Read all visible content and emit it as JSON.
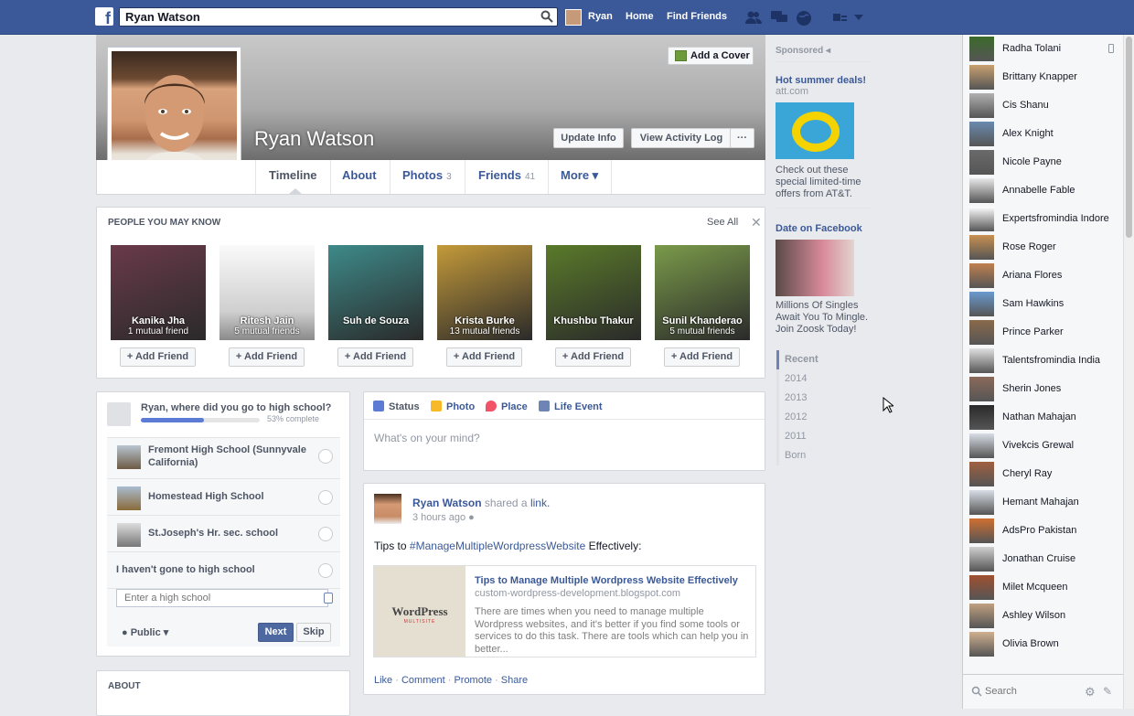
{
  "topbar": {
    "search_value": "Ryan Watson",
    "user_name": "Ryan",
    "home": "Home",
    "find_friends": "Find Friends"
  },
  "cover": {
    "add_cover": "Add a Cover",
    "name": "Ryan Watson",
    "update_info": "Update Info",
    "activity_log": "View Activity Log",
    "more_dots": "···"
  },
  "tabs": [
    {
      "label": "Timeline",
      "count": ""
    },
    {
      "label": "About",
      "count": ""
    },
    {
      "label": "Photos",
      "count": "3"
    },
    {
      "label": "Friends",
      "count": "41"
    },
    {
      "label": "More ▾",
      "count": ""
    }
  ],
  "pymk": {
    "title": "PEOPLE YOU MAY KNOW",
    "see_all": "See All",
    "add_label": "Add Friend",
    "people": [
      {
        "name": "Kanika Jha",
        "mutual": "1 mutual friend",
        "color": "#6a3a4a"
      },
      {
        "name": "Ritesh Jain",
        "mutual": "5 mutual friends",
        "color": "#e8e8e8"
      },
      {
        "name": "Suh de Souza",
        "mutual": "",
        "color": "#3e8a8a"
      },
      {
        "name": "Krista Burke",
        "mutual": "13 mutual friends",
        "color": "#c49a3a"
      },
      {
        "name": "Khushbu Thakur",
        "mutual": "",
        "color": "#5a7a2a"
      },
      {
        "name": "Sunil Khanderao",
        "mutual": "5 mutual friends",
        "color": "#7a9a4a"
      }
    ]
  },
  "highschool": {
    "question": "Ryan, where did you go to high school?",
    "progress_percent": 53,
    "progress_text": "53% complete",
    "options": [
      "Fremont High School (Sunnyvale California)",
      "Homestead High School",
      "St.Joseph's Hr. sec. school",
      "I haven't gone to high school"
    ],
    "input_placeholder": "Enter a high school",
    "privacy": "Public",
    "next": "Next",
    "skip": "Skip"
  },
  "about": {
    "title": "ABOUT"
  },
  "composer": {
    "status": "Status",
    "photo": "Photo",
    "place": "Place",
    "life_event": "Life Event",
    "placeholder": "What's on your mind?"
  },
  "post": {
    "author": "Ryan Watson",
    "action": "shared a",
    "link_word": "link.",
    "time": "3 hours ago",
    "text_prefix": "Tips to",
    "hashtag": "#ManageMultipleWordpressWebsite",
    "text_suffix": "Effectively:",
    "link_title": "Tips to Manage Multiple Wordpress Website Effectively",
    "link_domain": "custom-wordpress-development.blogspot.com",
    "link_desc": "There are times when you need to manage multiple Wordpress websites, and it's better if you find some tools or services to do this task. There are tools which can help you in better...",
    "thumb_text": "WordPress",
    "thumb_sub": "MULTISITE",
    "like": "Like",
    "comment": "Comment",
    "promote": "Promote",
    "share": "Share"
  },
  "sponsored": {
    "title": "Sponsored",
    "ad1_title": "Hot summer deals!",
    "ad1_src": "att.com",
    "ad1_text": "Check out these special limited-time offers from AT&T.",
    "ad2_title": "Date on Facebook",
    "ad2_text": "Millions Of Singles Await You To Mingle. Join Zoosk Today!"
  },
  "years": [
    "Recent",
    "2014",
    "2013",
    "2012",
    "2011",
    "Born"
  ],
  "chat": {
    "friends": [
      "Radha Tolani",
      "Brittany Knapper",
      "Cis Shanu",
      "Alex Knight",
      "Nicole Payne",
      "Annabelle Fable",
      "Expertsfromindia Indore",
      "Rose Roger",
      "Ariana Flores",
      "Sam Hawkins",
      "Prince Parker",
      "Talentsfromindia India",
      "Sherin Jones",
      "Nathan Mahajan",
      "Vivekcis Grewal",
      "Cheryl Ray",
      "Hemant Mahajan",
      "AdsPro Pakistan",
      "Jonathan Cruise",
      "Milet Mcqueen",
      "Ashley Wilson",
      "Olivia Brown"
    ],
    "search_placeholder": "Search"
  }
}
